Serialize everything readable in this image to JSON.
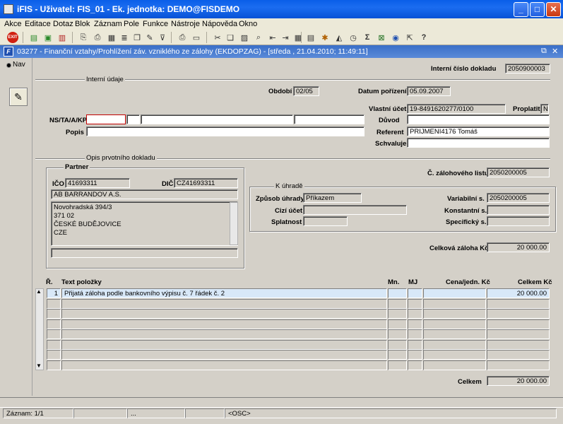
{
  "window": {
    "title": "iFIS - Uživatel: FIS_01 - Ek. jednotka: DEMO@FISDEMO"
  },
  "menu": [
    "Akce",
    "Editace",
    "Dotaz",
    "Blok",
    "Záznam",
    "Pole",
    "Funkce",
    "Nástroje",
    "Nápověda",
    "Okno"
  ],
  "inner_window": {
    "title": "03277 - Finanční vztahy/Prohlížení záv. vzniklého ze zálohy (EKDOPZAG) - [středa , 21.04.2010; 11:49:11]"
  },
  "nav": {
    "label": "Nav"
  },
  "header": {
    "interni_cislo_label": "Interní číslo dokladu",
    "interni_cislo": "2050900003",
    "interni_udaje": "Interní údaje",
    "obdobi_label": "Období",
    "obdobi": "02/05",
    "datum_label": "Datum pořízení",
    "datum": "05.09.2007",
    "vlastni_ucet_label": "Vlastní účet",
    "vlastni_ucet": "19-8491620277/0100",
    "proplatit_label": "Proplatit",
    "proplatit": "N",
    "nstakp_label": "NS/TA/A/KP",
    "duvod_label": "Důvod",
    "popis_label": "Popis",
    "referent_label": "Referent",
    "referent": "PRIJMENI4176 Tomáš",
    "schvaluje_label": "Schvaluje"
  },
  "opis": {
    "title": "Opis prvotního dokladu",
    "partner": "Partner",
    "ico_label": "IČO",
    "ico": "41693311",
    "dic_label": "DIČ",
    "dic": "CZ41693311",
    "name": "AB BARRANDOV A.S.",
    "address": [
      "Novohradská  394/3",
      "371 02",
      "ČESKÉ BUDĚJOVICE",
      "CZE"
    ],
    "cislo_zal_label": "Č. zálohového listu",
    "cislo_zal": "2050200005",
    "k_uhrade": "K úhradě",
    "zpusob_label": "Způsob úhrady",
    "zpusob": "Příkazem",
    "cizi_label": "Cizí účet",
    "splatnost_label": "Splatnost",
    "vs_label": "Variabilní s.",
    "vs": "2050200005",
    "ks_label": "Konstantní s.",
    "ss_label": "Specifický s.",
    "celkova_label": "Celková záloha Kč",
    "celkova": "20 000.00"
  },
  "table": {
    "headers": {
      "r": "Ř.",
      "text": "Text položky",
      "mn": "Mn.",
      "mj": "MJ",
      "cena": "Cena/jedn. Kč",
      "celkem": "Celkem Kč"
    },
    "rows": [
      {
        "r": "1",
        "text": "Přijatá záloha podle bankovního výpisu č. 7 řádek č. 2",
        "mn": "",
        "mj": "",
        "cena": "",
        "celkem": "20 000.00"
      }
    ],
    "total_label": "Celkem",
    "total": "20 000.00"
  },
  "status": {
    "zaznam": "Záznam: 1/1",
    "dots": "...",
    "osc": "<OSC>"
  }
}
